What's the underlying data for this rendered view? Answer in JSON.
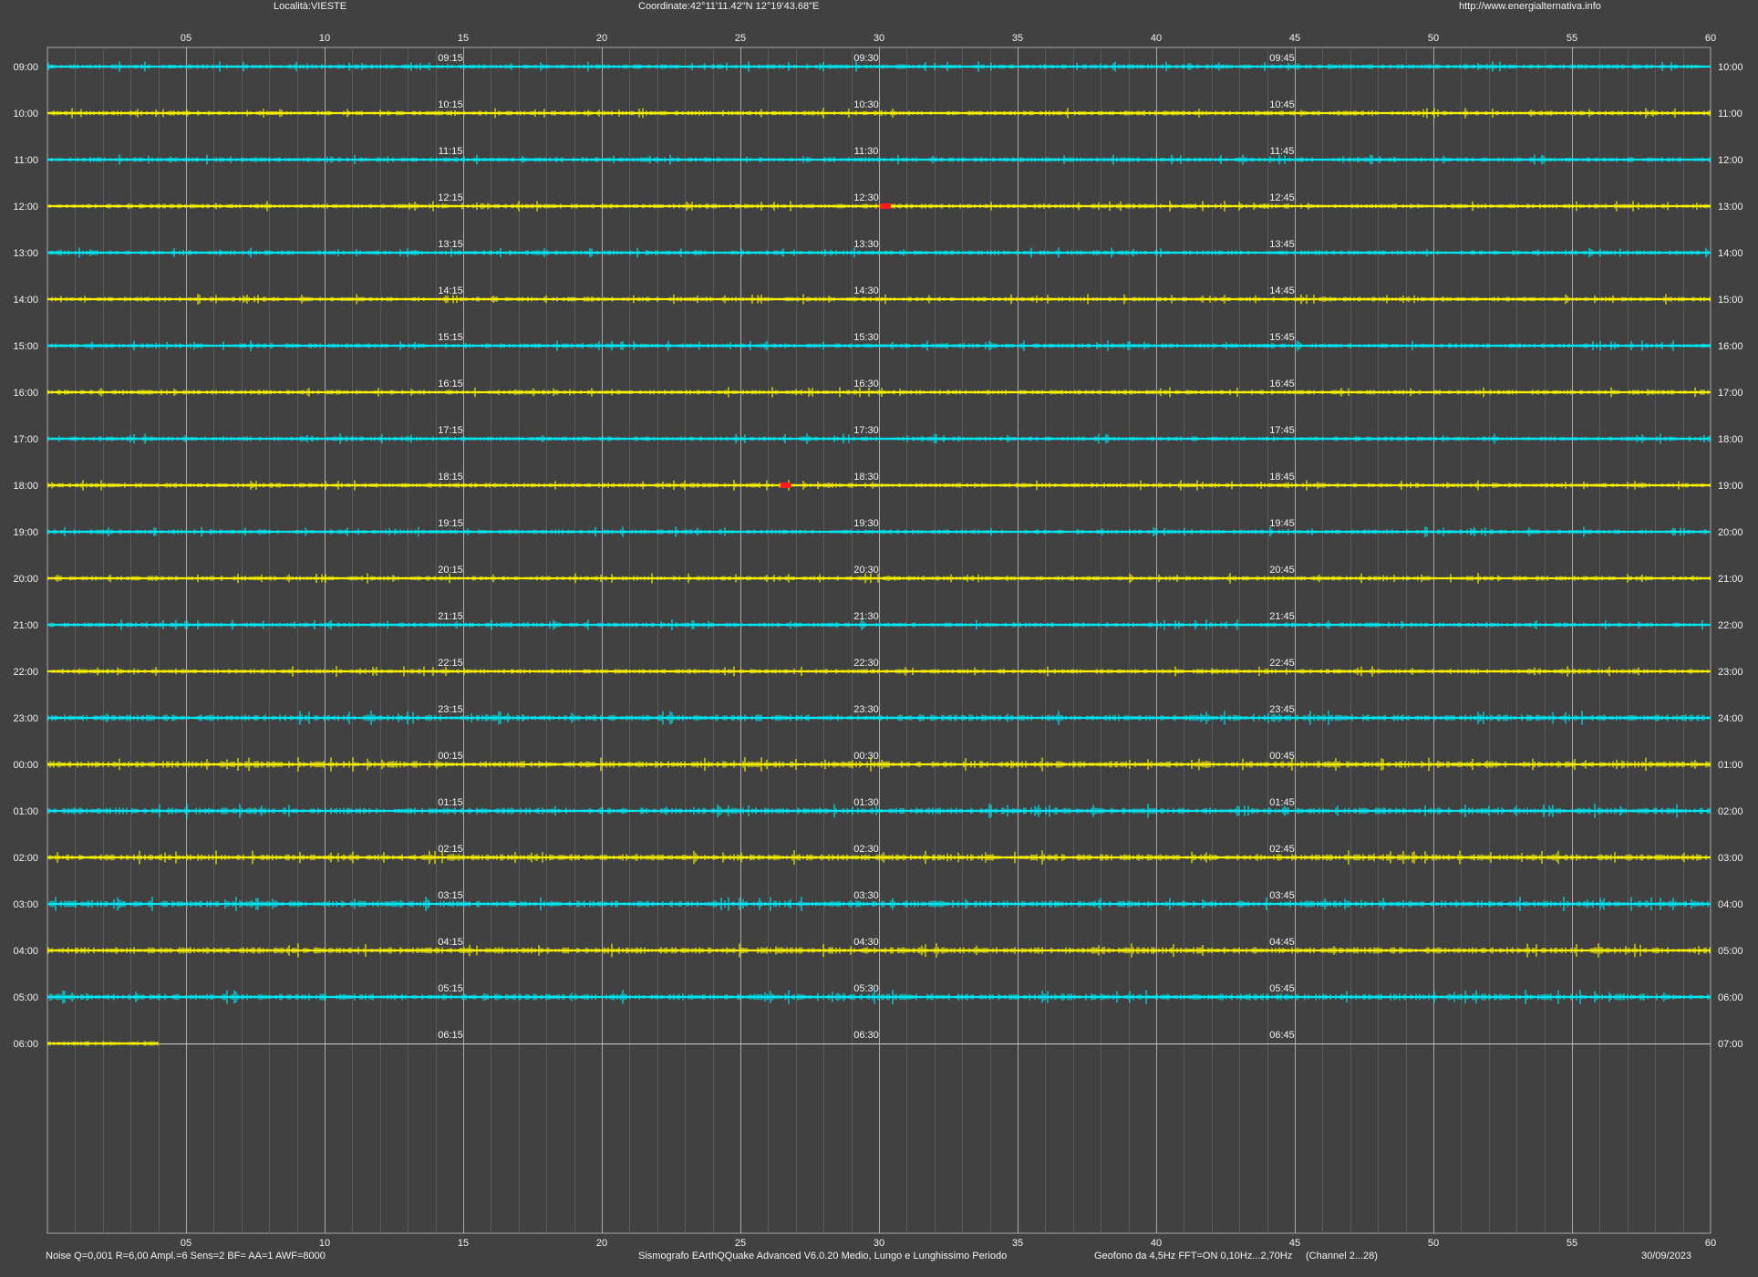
{
  "header": {
    "location": "Località:VIESTE",
    "coordinates": "Coordinate:42°11'11.42\"N  12°19'43.68\"E",
    "website": "http://www.energialternativa.info"
  },
  "footer": {
    "settings": "Noise Q=0,001 R=6,00 Ampl.=6 Sens=2 BF= AA=1 AWF=8000",
    "software": "Sismografo  EArthQQuake Advanced V6.0.20  Medio, Lungo e Lunghissimo Periodo",
    "sensor": "Geofono da 4,5Hz FFT=ON 0,10Hz...2,70Hz",
    "channel": "(Channel 2...28)",
    "date": "30/09/2023"
  },
  "colors": {
    "background": "#414141",
    "cyan_trace": "#00e5ef",
    "yellow_trace": "#f5f000",
    "event": "#ff1a1a",
    "grid_major": "#a9a9a9",
    "grid_minor": "#595959",
    "text": "#f2f2f2"
  },
  "chart_data": {
    "type": "helicorder",
    "x_unit": "minutes",
    "xlim": [
      0,
      60
    ],
    "x_ticks": [
      "05",
      "10",
      "15",
      "20",
      "25",
      "30",
      "35",
      "40",
      "45",
      "50",
      "55",
      "60"
    ],
    "major_grid_every_min": 5,
    "minor_grid_every_min": 1,
    "rows": [
      {
        "left": "09:00",
        "right": "10:00",
        "q": [
          "09:15",
          "09:30",
          "09:45"
        ],
        "color": "cyan",
        "noise": 2,
        "fill": 60
      },
      {
        "left": "10:00",
        "right": "11:00",
        "q": [
          "10:15",
          "10:30",
          "10:45"
        ],
        "color": "yellow",
        "noise": 2,
        "fill": 60
      },
      {
        "left": "11:00",
        "right": "12:00",
        "q": [
          "11:15",
          "11:30",
          "11:45"
        ],
        "color": "cyan",
        "noise": 2,
        "fill": 60
      },
      {
        "left": "12:00",
        "right": "13:00",
        "q": [
          "12:15",
          "12:30",
          "12:45"
        ],
        "color": "yellow",
        "noise": 2,
        "fill": 60
      },
      {
        "left": "13:00",
        "right": "14:00",
        "q": [
          "13:15",
          "13:30",
          "13:45"
        ],
        "color": "cyan",
        "noise": 2,
        "fill": 60
      },
      {
        "left": "14:00",
        "right": "15:00",
        "q": [
          "14:15",
          "14:30",
          "14:45"
        ],
        "color": "yellow",
        "noise": 2,
        "fill": 60
      },
      {
        "left": "15:00",
        "right": "16:00",
        "q": [
          "15:15",
          "15:30",
          "15:45"
        ],
        "color": "cyan",
        "noise": 2,
        "fill": 60
      },
      {
        "left": "16:00",
        "right": "17:00",
        "q": [
          "16:15",
          "16:30",
          "16:45"
        ],
        "color": "yellow",
        "noise": 2,
        "fill": 60
      },
      {
        "left": "17:00",
        "right": "18:00",
        "q": [
          "17:15",
          "17:30",
          "17:45"
        ],
        "color": "cyan",
        "noise": 2,
        "fill": 60
      },
      {
        "left": "18:00",
        "right": "19:00",
        "q": [
          "18:15",
          "18:30",
          "18:45"
        ],
        "color": "yellow",
        "noise": 2,
        "fill": 60
      },
      {
        "left": "19:00",
        "right": "20:00",
        "q": [
          "19:15",
          "19:30",
          "19:45"
        ],
        "color": "cyan",
        "noise": 2,
        "fill": 60
      },
      {
        "left": "20:00",
        "right": "21:00",
        "q": [
          "20:15",
          "20:30",
          "20:45"
        ],
        "color": "yellow",
        "noise": 2,
        "fill": 60
      },
      {
        "left": "21:00",
        "right": "22:00",
        "q": [
          "21:15",
          "21:30",
          "21:45"
        ],
        "color": "cyan",
        "noise": 2,
        "fill": 60
      },
      {
        "left": "22:00",
        "right": "23:00",
        "q": [
          "22:15",
          "22:30",
          "22:45"
        ],
        "color": "yellow",
        "noise": 2,
        "fill": 60
      },
      {
        "left": "23:00",
        "right": "24:00",
        "q": [
          "23:15",
          "23:30",
          "23:45"
        ],
        "color": "cyan",
        "noise": 3,
        "fill": 60
      },
      {
        "left": "00:00",
        "right": "01:00",
        "q": [
          "00:15",
          "00:30",
          "00:45"
        ],
        "color": "yellow",
        "noise": 3,
        "fill": 60
      },
      {
        "left": "01:00",
        "right": "02:00",
        "q": [
          "01:15",
          "01:30",
          "01:45"
        ],
        "color": "cyan",
        "noise": 3,
        "fill": 60
      },
      {
        "left": "02:00",
        "right": "03:00",
        "q": [
          "02:15",
          "02:30",
          "02:45"
        ],
        "color": "yellow",
        "noise": 3,
        "fill": 60
      },
      {
        "left": "03:00",
        "right": "04:00",
        "q": [
          "03:15",
          "03:30",
          "03:45"
        ],
        "color": "cyan",
        "noise": 3,
        "fill": 60
      },
      {
        "left": "04:00",
        "right": "05:00",
        "q": [
          "04:15",
          "04:30",
          "04:45"
        ],
        "color": "yellow",
        "noise": 3,
        "fill": 60
      },
      {
        "left": "05:00",
        "right": "06:00",
        "q": [
          "05:15",
          "05:30",
          "05:45"
        ],
        "color": "cyan",
        "noise": 3,
        "fill": 60
      },
      {
        "left": "06:00",
        "right": "07:00",
        "q": [
          "06:15",
          "06:30",
          "06:45"
        ],
        "color": "yellow",
        "noise": 2,
        "fill": 4
      }
    ],
    "events": [
      {
        "row": "12:00",
        "minute": 30.2
      },
      {
        "row": "18:00",
        "minute": 26.6
      }
    ]
  }
}
